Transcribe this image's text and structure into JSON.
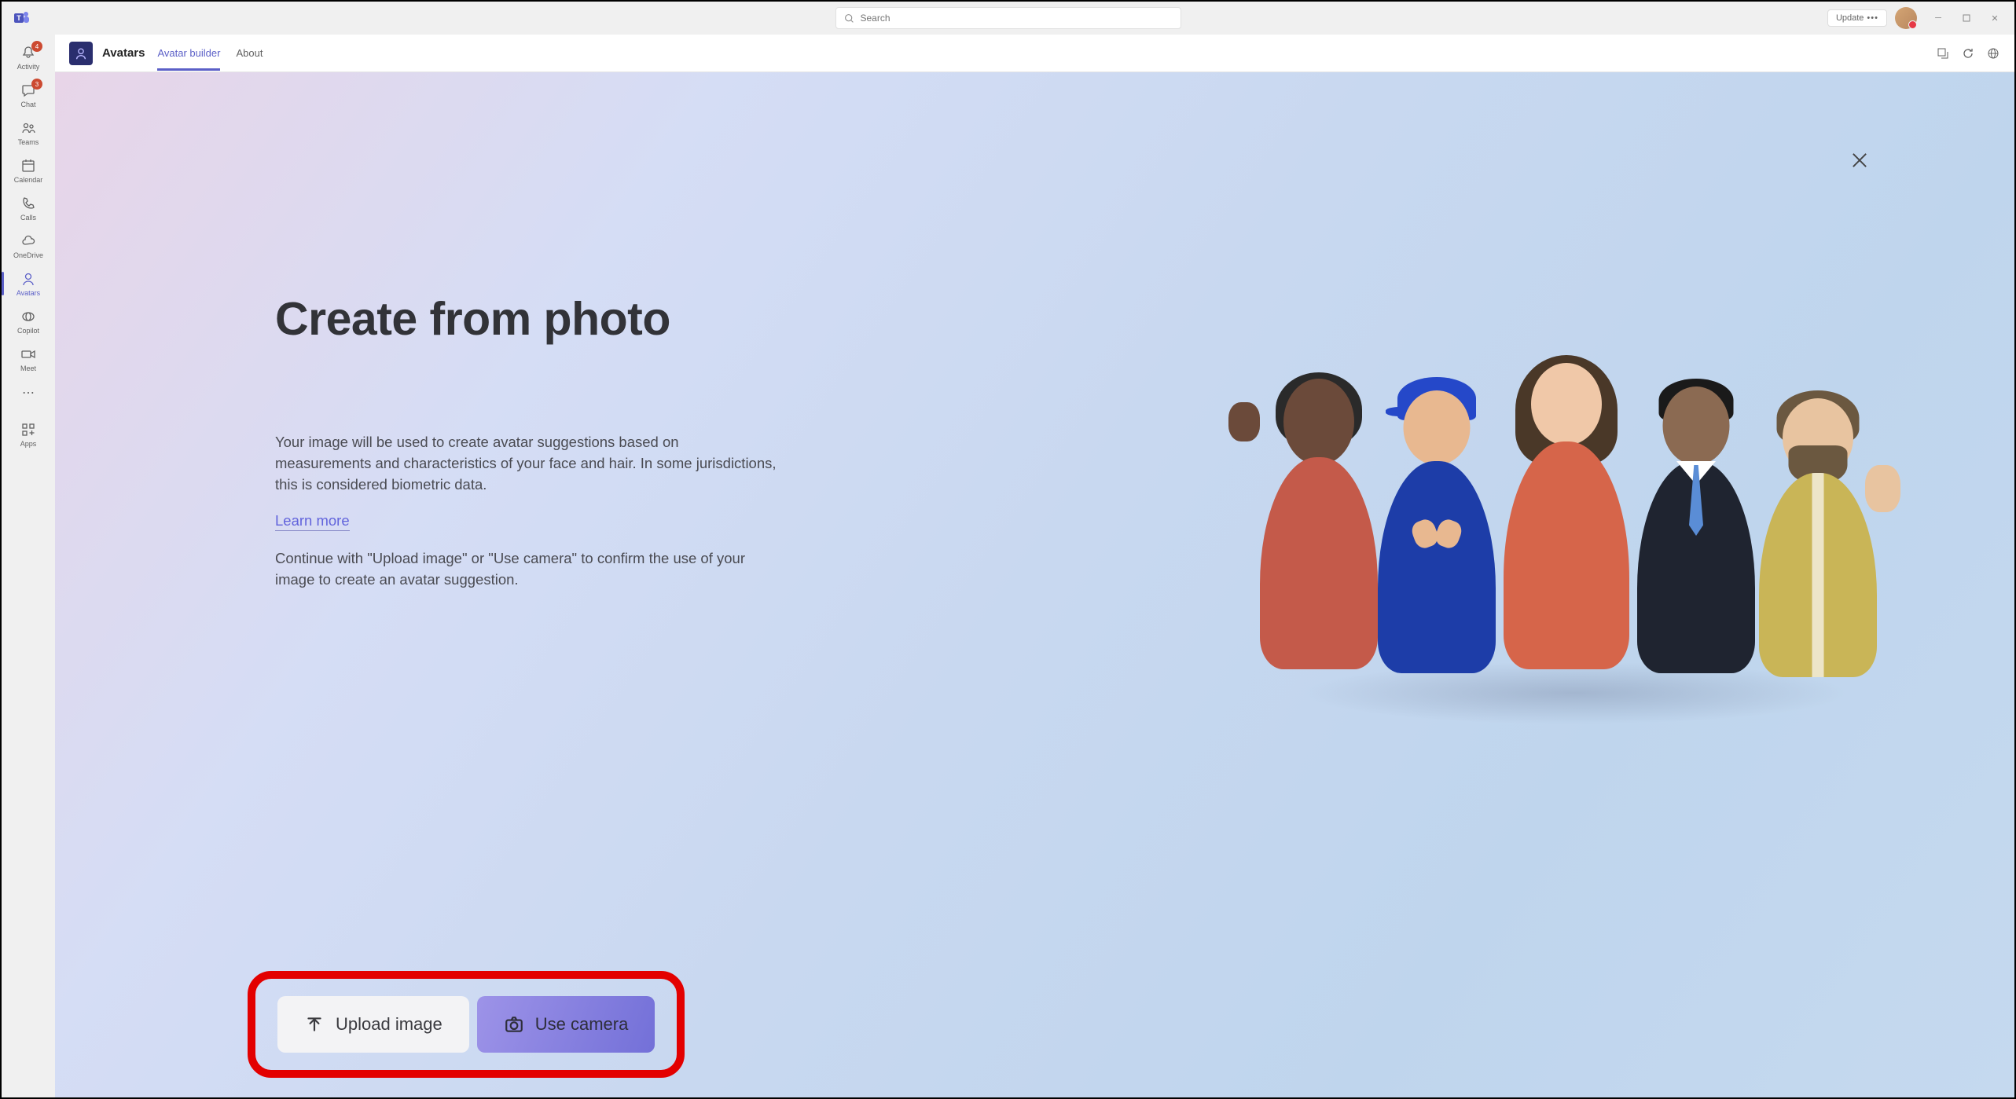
{
  "titlebar": {
    "search_placeholder": "Search",
    "update_label": "Update"
  },
  "left_rail": {
    "items": [
      {
        "label": "Activity",
        "badge": "4"
      },
      {
        "label": "Chat",
        "badge": "3"
      },
      {
        "label": "Teams",
        "badge": ""
      },
      {
        "label": "Calendar",
        "badge": ""
      },
      {
        "label": "Calls",
        "badge": ""
      },
      {
        "label": "OneDrive",
        "badge": ""
      },
      {
        "label": "Avatars",
        "badge": ""
      },
      {
        "label": "Copilot",
        "badge": ""
      },
      {
        "label": "Meet",
        "badge": ""
      }
    ],
    "apps_label": "Apps"
  },
  "app_header": {
    "title": "Avatars",
    "tabs": [
      {
        "label": "Avatar builder"
      },
      {
        "label": "About"
      }
    ]
  },
  "page": {
    "heading": "Create from photo",
    "description1": "Your image will be used to create avatar suggestions based on measurements and characteristics of your face and hair. In some jurisdictions, this is considered biometric data.",
    "learn_more": "Learn more",
    "description2": "Continue with \"Upload image\" or \"Use camera\" to confirm the use of your image to create an avatar suggestion.",
    "upload_label": "Upload image",
    "camera_label": "Use camera"
  }
}
